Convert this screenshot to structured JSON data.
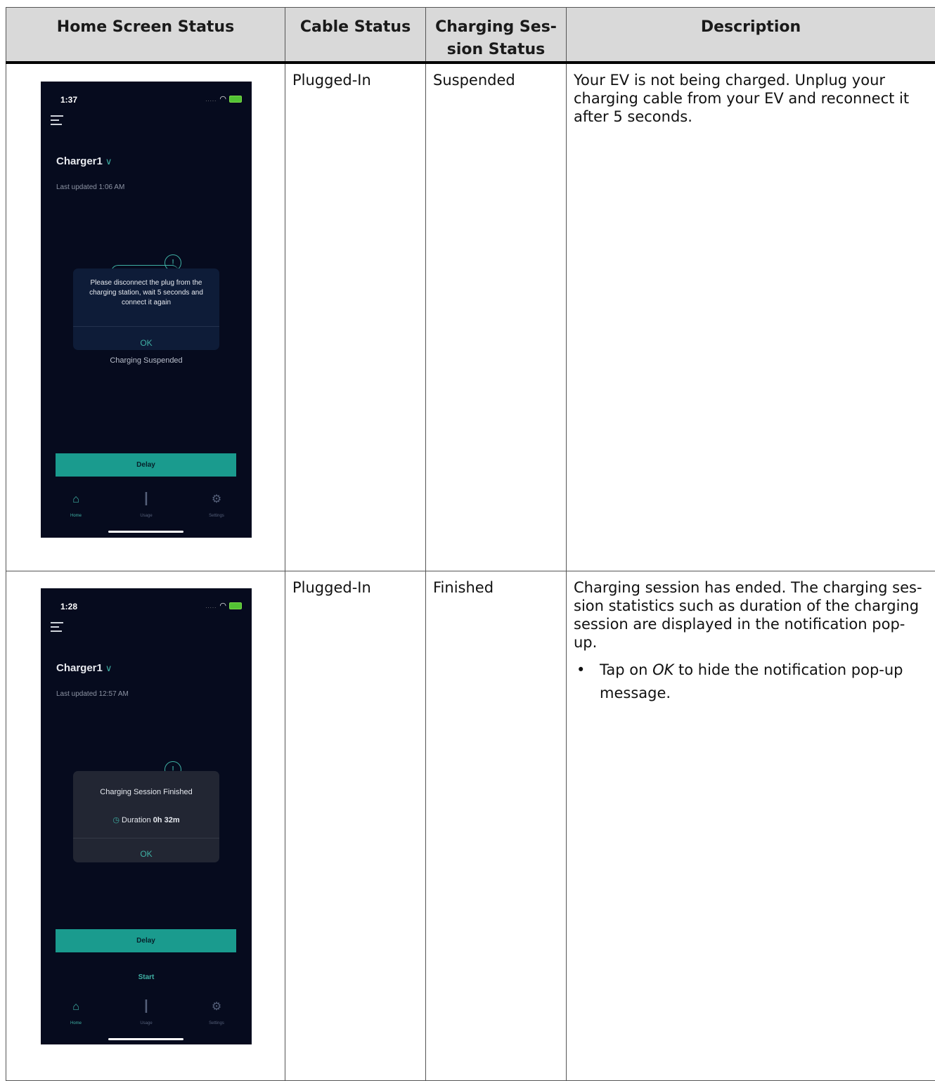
{
  "table": {
    "headers": {
      "home_screen_status": "Home Screen Status",
      "cable_status": "Cable Status",
      "charging_session_status": "Charging Ses-\nsion Status",
      "description": "Description"
    },
    "rows": [
      {
        "cable_status": "Plugged-In",
        "session_status": "Suspended",
        "description": "Your EV is not being charged. Unplug your charging cable from your EV and reconnect it after 5 seconds.",
        "phone": {
          "time": "1:37",
          "status_dots": ".....",
          "charger": "Charger1",
          "last_updated": "Last updated 1:06 AM",
          "dialog_text": "Please disconnect the plug from the charging station, wait 5 seconds and connect it again",
          "dialog_ok": "OK",
          "status_text": "Charging Suspended",
          "delay_label": "Delay",
          "nav": {
            "home": "Home",
            "usage": "Usage",
            "settings": "Settings"
          }
        }
      },
      {
        "cable_status": "Plugged-In",
        "session_status": "Finished",
        "description": "Charging session has ended. The charging ses-sion statistics such as duration of the charging session are displayed in the notification pop-up.",
        "bullet_prefix": "Tap on ",
        "bullet_em": "OK",
        "bullet_suffix": " to hide the notification pop-up message.",
        "phone": {
          "time": "1:28",
          "status_dots": ".....",
          "charger": "Charger1",
          "last_updated": "Last updated 12:57 AM",
          "dialog_title": "Charging Session Finished",
          "duration_label": "Duration",
          "duration_value": "0h 32m",
          "dialog_ok": "OK",
          "delay_label": "Delay",
          "start_label": "Start",
          "nav": {
            "home": "Home",
            "usage": "Usage",
            "settings": "Settings"
          }
        }
      }
    ]
  },
  "colors": {
    "header_bg": "#d9d9d9",
    "phone_bg": "#060b1e",
    "accent": "#1a9b8e",
    "dialog_blue": "#0e1c38"
  },
  "icons": [
    "menu-icon",
    "chevron-down-icon",
    "alert-circle-icon",
    "wifi-icon",
    "battery-icon",
    "home-icon",
    "usage-icon",
    "settings-icon",
    "clock-icon"
  ]
}
